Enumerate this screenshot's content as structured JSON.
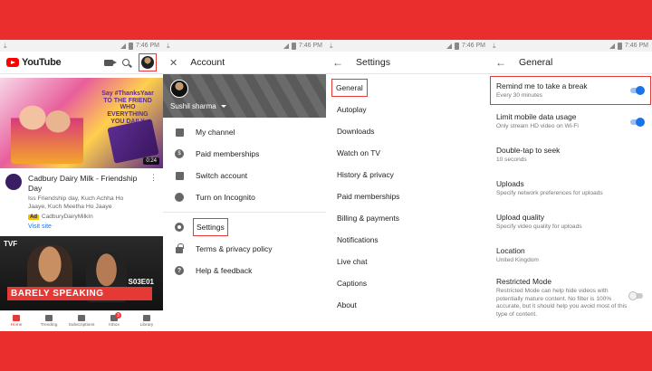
{
  "status": {
    "time": "7:46 PM"
  },
  "home": {
    "logo_text": "YouTube",
    "video1": {
      "slogan": "Say #ThanksYaar TO THE FRIEND WHO EVERYTHING YOU DAILY",
      "duration": "0:24",
      "title": "Cadbury Dairy Milk - Friendship Day",
      "desc": "Iss Friendship day, Kuch Achha Ho Jaaye, Kuch Meetha Ho Jaaye",
      "ad_label": "Ad",
      "channel": "CadburyDairyMilkIn",
      "visit": "Visit site"
    },
    "video2": {
      "tvf": "TVF",
      "episode": "S03E01",
      "title": "BARELY SPEAKING"
    },
    "nav": [
      {
        "label": "Home"
      },
      {
        "label": "Trending"
      },
      {
        "label": "Subscriptions"
      },
      {
        "label": "Inbox",
        "badge": "3"
      },
      {
        "label": "Library"
      }
    ]
  },
  "account": {
    "title": "Account",
    "user": "Sushil sharma",
    "items": [
      "My channel",
      "Paid memberships",
      "Switch account",
      "Turn on Incognito",
      "Settings",
      "Terms & privacy policy",
      "Help & feedback"
    ]
  },
  "settings": {
    "title": "Settings",
    "items": [
      "General",
      "Autoplay",
      "Downloads",
      "Watch on TV",
      "History & privacy",
      "Paid memberships",
      "Billing & payments",
      "Notifications",
      "Live chat",
      "Captions",
      "About"
    ]
  },
  "general": {
    "title": "General",
    "items": [
      {
        "title": "Remind me to take a break",
        "sub": "Every 30 minutes",
        "toggle": "on"
      },
      {
        "title": "Limit mobile data usage",
        "sub": "Only stream HD video on Wi-Fi",
        "toggle": "on"
      },
      {
        "title": "Double-tap to seek",
        "sub": "10 seconds"
      },
      {
        "title": "Uploads",
        "sub": "Specify network preferences for uploads"
      },
      {
        "title": "Upload quality",
        "sub": "Specify video quality for uploads"
      },
      {
        "title": "Location",
        "sub": "United Kingdom"
      },
      {
        "title": "Restricted Mode",
        "sub": "Restricted Mode can help hide videos with potentially mature content. No filter is 100% accurate, but it should help you avoid most of this type of content.",
        "toggle": "off"
      }
    ]
  }
}
